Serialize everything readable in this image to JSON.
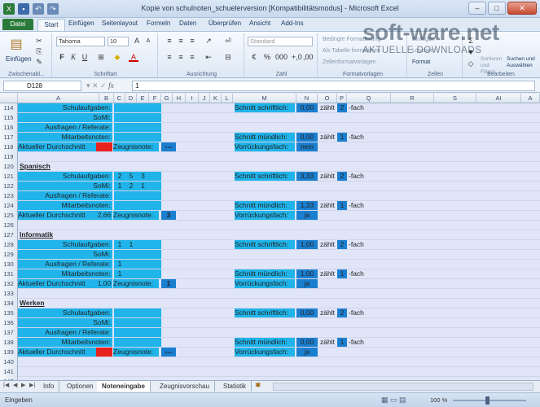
{
  "window": {
    "title": "Kopie von schulnoten_schuelerversion  [Kompatibilitätsmodus]  -  Microsoft Excel",
    "minimize": "–",
    "maximize": "□",
    "close": "✕"
  },
  "ribbon_tabs": [
    "Datei",
    "Start",
    "Einfügen",
    "Seitenlayout",
    "Formeln",
    "Daten",
    "Überprüfen",
    "Ansicht",
    "Add-Ins"
  ],
  "ribbon": {
    "paste_label": "Einfügen",
    "clipboard_label": "Zwischenabl...",
    "font_name": "Tahoma",
    "font_size": "10",
    "font_group_label": "Schriftart",
    "align_group_label": "Ausrichtung",
    "number_format": "Standard",
    "number_group_label": "Zahl",
    "cond_format": "Bedingte Formatierung",
    "table_format": "Als Tabelle formatieren",
    "cell_styles": "Zellenformatvorlagen",
    "styles_group_label": "Formatvorlagen",
    "insert_label": "Einfügen",
    "delete_label": "Löschen",
    "format_label": "Format",
    "cells_group_label": "Zellen",
    "sort_label": "Sortieren und Filtern",
    "find_label": "Suchen und Auswählen",
    "edit_group_label": "Bearbeiten"
  },
  "watermark": {
    "line1": "soft-ware.net",
    "line2": "AKTUELLE DOWNLOADS"
  },
  "formula_bar": {
    "name_box": "D128",
    "fx": "fx",
    "value": "1"
  },
  "columns": [
    "A",
    "B",
    "C",
    "D",
    "E",
    "F",
    "G",
    "H",
    "I",
    "J",
    "K",
    "L",
    "M",
    "N",
    "O",
    "P",
    "Q",
    "R",
    "S",
    "AI",
    "A"
  ],
  "rows": [
    {
      "num": "114",
      "a": "Schulaufgaben:",
      "m": "Schnitt schriftlich:",
      "n": "0,00",
      "o": "zählt",
      "p": "2",
      "q": "-fach"
    },
    {
      "num": "115",
      "a": "SoMi:"
    },
    {
      "num": "116",
      "a": "Ausfragen / Referate:"
    },
    {
      "num": "117",
      "a": "Mitarbeitsnoten:",
      "m": "Schnitt mündlich:",
      "n": "0,00",
      "o": "zählt",
      "p": "1",
      "q": "-fach"
    },
    {
      "num": "118",
      "avg_label": "Aktueller Durchschnitt",
      "avg": "",
      "zeugnis_label": "Zeugnisnote:",
      "zeugnis": "---",
      "m": "Vorrückungsfach:",
      "n": "nein",
      "avg_red": true
    },
    {
      "num": "119"
    },
    {
      "num": "120",
      "subject": "Spanisch"
    },
    {
      "num": "121",
      "a": "Schulaufgaben:",
      "c": "2",
      "d": "5",
      "e": "3",
      "m": "Schnitt schriftlich:",
      "n": "3,33",
      "o": "zählt",
      "p": "2",
      "q": "-fach"
    },
    {
      "num": "122",
      "a": "SoMi:",
      "c": "1",
      "d": "2",
      "e": "1"
    },
    {
      "num": "123",
      "a": "Ausfragen / Referate:"
    },
    {
      "num": "124",
      "a": "Mitarbeitsnoten:",
      "m": "Schnitt mündlich:",
      "n": "1,33",
      "o": "zählt",
      "p": "1",
      "q": "-fach"
    },
    {
      "num": "125",
      "avg_label": "Aktueller Durchschnitt",
      "avg": "2,66",
      "zeugnis_label": "Zeugnisnote:",
      "zeugnis": "3",
      "m": "Vorrückungsfach:",
      "n": "ja"
    },
    {
      "num": "126"
    },
    {
      "num": "127",
      "subject": "Informatik"
    },
    {
      "num": "128",
      "a": "Schulaufgaben:",
      "c": "1",
      "d": "1",
      "m": "Schnitt schriftlich:",
      "n": "1,00",
      "o": "zählt",
      "p": "2",
      "q": "-fach"
    },
    {
      "num": "129",
      "a": "SoMi:"
    },
    {
      "num": "130",
      "a": "Ausfragen / Referate:",
      "c": "1"
    },
    {
      "num": "131",
      "a": "Mitarbeitsnoten:",
      "c": "1",
      "m": "Schnitt mündlich:",
      "n": "1,00",
      "o": "zählt",
      "p": "1",
      "q": "-fach"
    },
    {
      "num": "132",
      "avg_label": "Aktueller Durchschnitt",
      "avg": "1,00",
      "zeugnis_label": "Zeugnisnote:",
      "zeugnis": "1",
      "m": "Vorrückungsfach:",
      "n": "ja"
    },
    {
      "num": "133"
    },
    {
      "num": "134",
      "subject": "Werken"
    },
    {
      "num": "135",
      "a": "Schulaufgaben:",
      "m": "Schnitt schriftlich:",
      "n": "0,00",
      "o": "zählt",
      "p": "2",
      "q": "-fach"
    },
    {
      "num": "136",
      "a": "SoMi:"
    },
    {
      "num": "137",
      "a": "Ausfragen / Referate:"
    },
    {
      "num": "138",
      "a": "Mitarbeitsnoten:",
      "m": "Schnitt mündlich:",
      "n": "0,00",
      "o": "zählt",
      "p": "1",
      "q": "-fach"
    },
    {
      "num": "139",
      "avg_label": "Aktueller Durchschnitt",
      "avg": "",
      "zeugnis_label": "Zeugnisnote:",
      "zeugnis": "---",
      "m": "Vorrückungsfach:",
      "n": "ja",
      "avg_red": true
    },
    {
      "num": "140"
    },
    {
      "num": "141"
    },
    {
      "num": "142"
    }
  ],
  "sheet_tabs": [
    "Info",
    "Optionen",
    "Noteneingabe",
    "Zeugnisvorschau",
    "Statistik"
  ],
  "active_sheet": "Noteneingabe",
  "status": {
    "mode": "Eingeben",
    "zoom": "100 %"
  }
}
